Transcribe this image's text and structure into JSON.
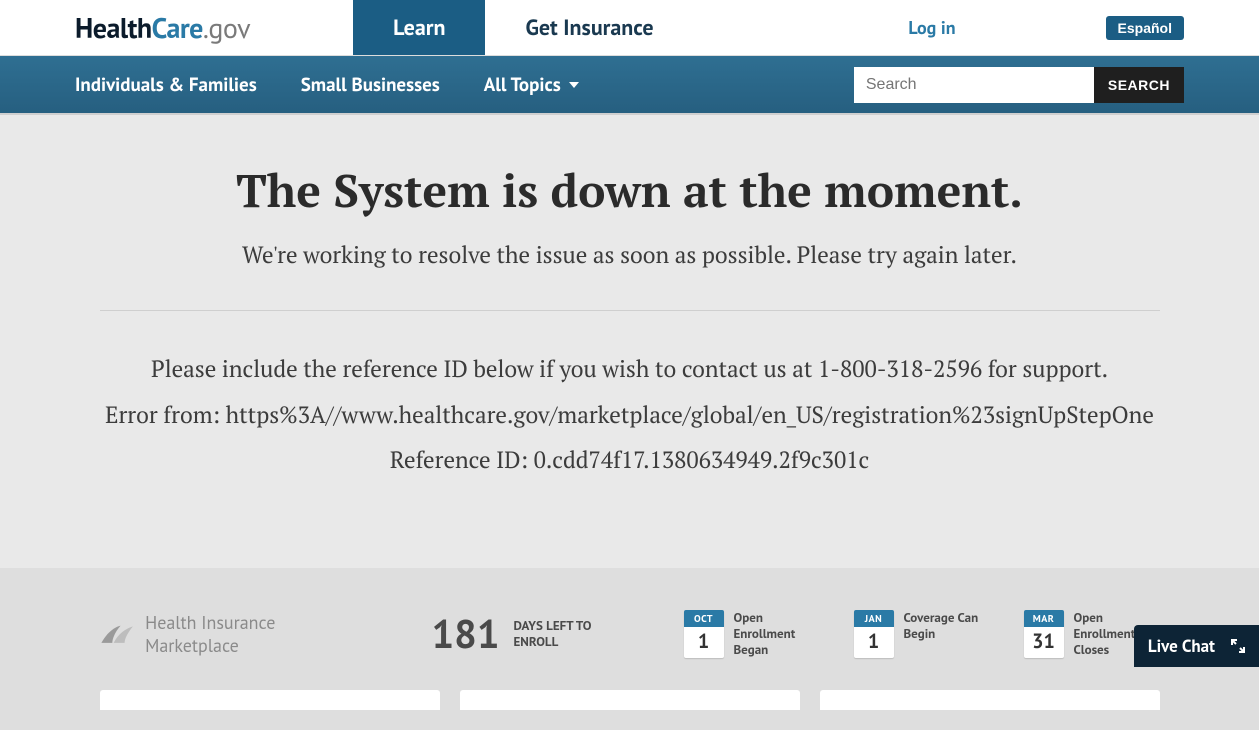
{
  "header": {
    "logo": {
      "part1": "Health",
      "part2": "Care",
      "part3": ".gov"
    },
    "nav": {
      "learn": "Learn",
      "get_insurance": "Get Insurance"
    },
    "login": "Log in",
    "language": "Español"
  },
  "secondnav": {
    "individuals": "Individuals & Families",
    "small_biz": "Small Businesses",
    "all_topics": "All Topics",
    "search_placeholder": "Search",
    "search_button": "SEARCH"
  },
  "error": {
    "heading": "The System is down at the moment.",
    "subheading": "We're working to resolve the issue as soon as possible. Please try again later.",
    "contact_line": "Please include the reference ID below if you wish to contact us at 1-800-318-2596 for support.",
    "error_from": "Error from: https%3A//www.healthcare.gov/marketplace/global/en_US/registration%23signUpStepOne",
    "reference": "Reference ID: 0.cdd74f17.1380634949.2f9c301c"
  },
  "footer": {
    "marketplace_label": "Health Insurance Marketplace",
    "countdown": {
      "number": "181",
      "label": "DAYS LEFT TO ENROLL"
    },
    "dates": [
      {
        "month": "OCT",
        "day": "1",
        "text": "Open Enrollment Began"
      },
      {
        "month": "JAN",
        "day": "1",
        "text": "Coverage Can Begin"
      },
      {
        "month": "MAR",
        "day": "31",
        "text": "Open Enrollment Closes"
      }
    ]
  },
  "livechat": {
    "label": "Live Chat"
  }
}
